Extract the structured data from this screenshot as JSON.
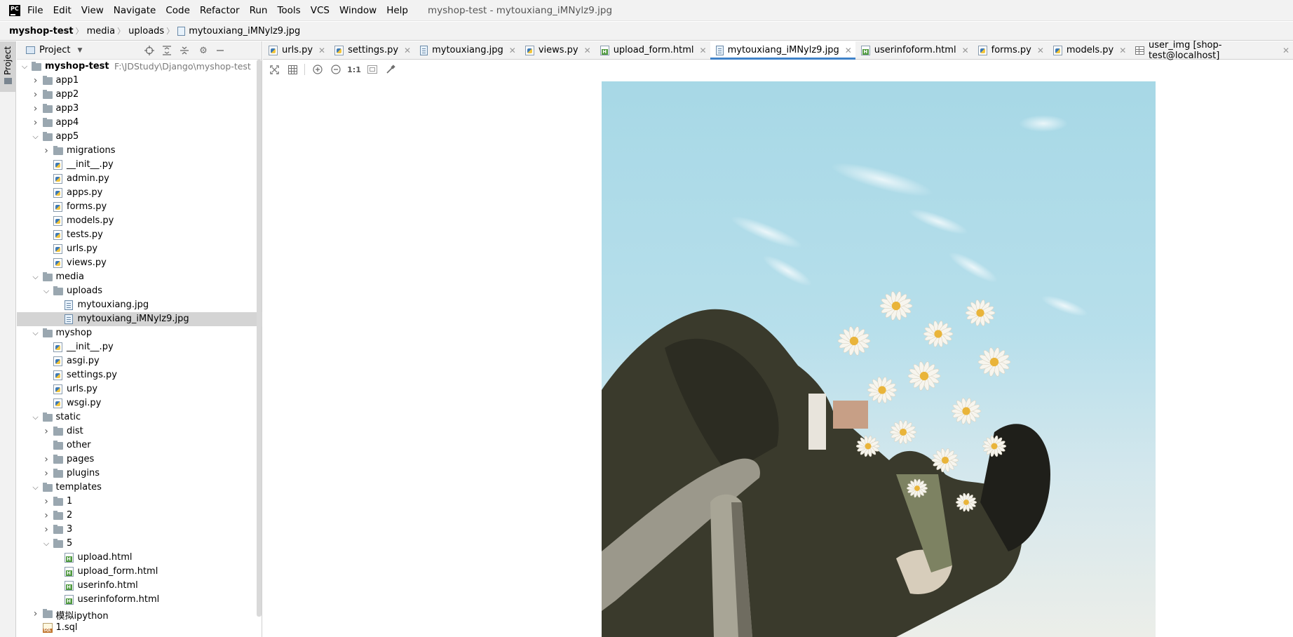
{
  "menu": {
    "items": [
      "File",
      "Edit",
      "View",
      "Navigate",
      "Code",
      "Refactor",
      "Run",
      "Tools",
      "VCS",
      "Window",
      "Help"
    ],
    "window_title": "myshop-test - mytouxiang_iMNylz9.jpg"
  },
  "breadcrumb": {
    "items": [
      "myshop-test",
      "media",
      "uploads",
      "mytouxiang_iMNylz9.jpg"
    ]
  },
  "side_stripe": {
    "project_label": "Project"
  },
  "project_panel": {
    "title": "Project",
    "tree": [
      {
        "label": "myshop-test",
        "path": "F:\\JDStudy\\Django\\myshop-test",
        "type": "root",
        "depth": 0,
        "expanded": true
      },
      {
        "label": "app1",
        "type": "folder",
        "depth": 1,
        "expanded": false
      },
      {
        "label": "app2",
        "type": "folder",
        "depth": 1,
        "expanded": false
      },
      {
        "label": "app3",
        "type": "folder",
        "depth": 1,
        "expanded": false
      },
      {
        "label": "app4",
        "type": "folder",
        "depth": 1,
        "expanded": false
      },
      {
        "label": "app5",
        "type": "folder",
        "depth": 1,
        "expanded": true
      },
      {
        "label": "migrations",
        "type": "folder",
        "depth": 2,
        "expanded": false
      },
      {
        "label": "__init__.py",
        "type": "py",
        "depth": 2
      },
      {
        "label": "admin.py",
        "type": "py",
        "depth": 2
      },
      {
        "label": "apps.py",
        "type": "py",
        "depth": 2
      },
      {
        "label": "forms.py",
        "type": "py",
        "depth": 2
      },
      {
        "label": "models.py",
        "type": "py",
        "depth": 2
      },
      {
        "label": "tests.py",
        "type": "py",
        "depth": 2
      },
      {
        "label": "urls.py",
        "type": "py",
        "depth": 2
      },
      {
        "label": "views.py",
        "type": "py",
        "depth": 2
      },
      {
        "label": "media",
        "type": "folder",
        "depth": 1,
        "expanded": true
      },
      {
        "label": "uploads",
        "type": "folder",
        "depth": 2,
        "expanded": true
      },
      {
        "label": "mytouxiang.jpg",
        "type": "img",
        "depth": 3
      },
      {
        "label": "mytouxiang_iMNylz9.jpg",
        "type": "img",
        "depth": 3,
        "selected": true
      },
      {
        "label": "myshop",
        "type": "folder",
        "depth": 1,
        "expanded": true
      },
      {
        "label": "__init__.py",
        "type": "py",
        "depth": 2
      },
      {
        "label": "asgi.py",
        "type": "py",
        "depth": 2
      },
      {
        "label": "settings.py",
        "type": "py",
        "depth": 2
      },
      {
        "label": "urls.py",
        "type": "py",
        "depth": 2
      },
      {
        "label": "wsgi.py",
        "type": "py",
        "depth": 2
      },
      {
        "label": "static",
        "type": "folder",
        "depth": 1,
        "expanded": true
      },
      {
        "label": "dist",
        "type": "folder",
        "depth": 2,
        "expanded": false
      },
      {
        "label": "other",
        "type": "folder",
        "depth": 2,
        "leaf": true
      },
      {
        "label": "pages",
        "type": "folder",
        "depth": 2,
        "expanded": false
      },
      {
        "label": "plugins",
        "type": "folder",
        "depth": 2,
        "expanded": false
      },
      {
        "label": "templates",
        "type": "folder",
        "depth": 1,
        "expanded": true
      },
      {
        "label": "1",
        "type": "folder",
        "depth": 2,
        "expanded": false
      },
      {
        "label": "2",
        "type": "folder",
        "depth": 2,
        "expanded": false
      },
      {
        "label": "3",
        "type": "folder",
        "depth": 2,
        "expanded": false
      },
      {
        "label": "5",
        "type": "folder",
        "depth": 2,
        "expanded": true
      },
      {
        "label": "upload.html",
        "type": "html",
        "depth": 3
      },
      {
        "label": "upload_form.html",
        "type": "html",
        "depth": 3
      },
      {
        "label": "userinfo.html",
        "type": "html",
        "depth": 3
      },
      {
        "label": "userinfoform.html",
        "type": "html",
        "depth": 3
      },
      {
        "label": "模拟ipython",
        "type": "folder",
        "depth": 1,
        "expanded": false
      },
      {
        "label": "1.sql",
        "type": "sql",
        "depth": 1
      }
    ]
  },
  "editor": {
    "tabs": [
      {
        "label": "urls.py",
        "icon": "py"
      },
      {
        "label": "settings.py",
        "icon": "py"
      },
      {
        "label": "mytouxiang.jpg",
        "icon": "img"
      },
      {
        "label": "views.py",
        "icon": "py"
      },
      {
        "label": "upload_form.html",
        "icon": "html"
      },
      {
        "label": "mytouxiang_iMNylz9.jpg",
        "icon": "img",
        "active": true
      },
      {
        "label": "userinfoform.html",
        "icon": "html"
      },
      {
        "label": "forms.py",
        "icon": "py"
      },
      {
        "label": "models.py",
        "icon": "py"
      },
      {
        "label": "user_img [shop-test@localhost]",
        "icon": "table"
      }
    ],
    "image_toolbar": {
      "actual_size_label": "1:1"
    }
  },
  "colors": {
    "accent": "#4083c9",
    "selection": "#d4d4d4",
    "chrome": "#f2f2f2"
  }
}
